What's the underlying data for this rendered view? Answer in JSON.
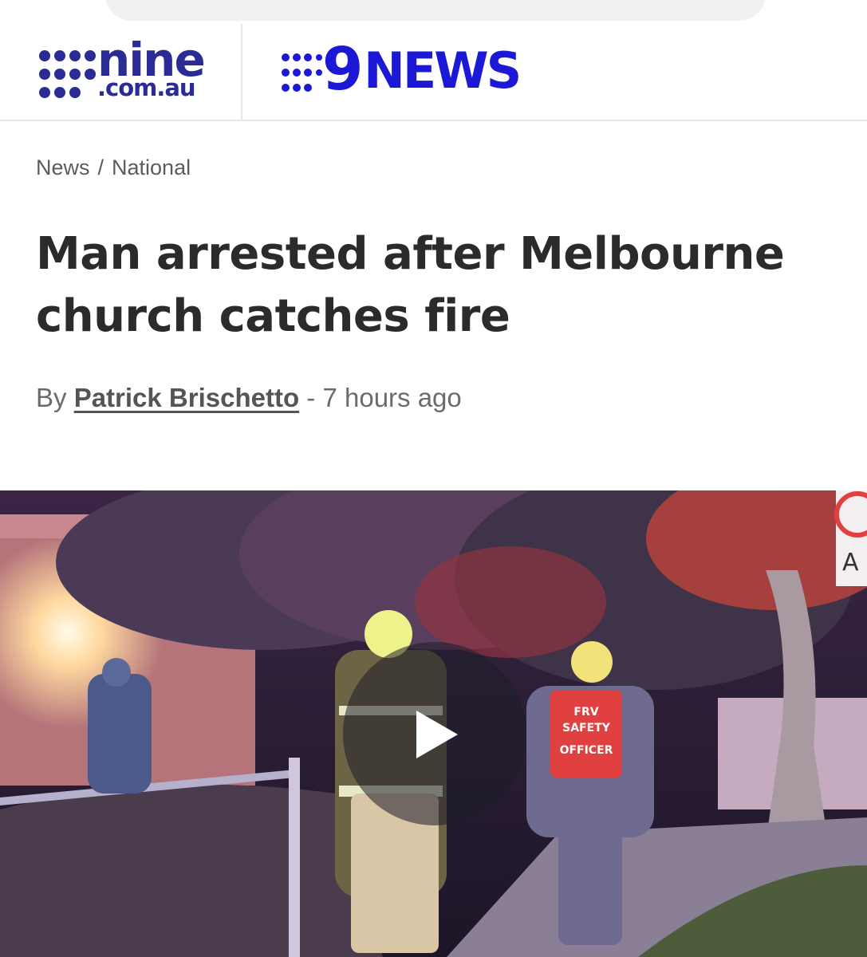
{
  "header": {
    "nine_logo": {
      "word": "nine",
      "domain": ".com.au",
      "color": "#2b2b96"
    },
    "news_logo": {
      "numeral": "9",
      "word": "NEWS",
      "color": "#1b18d6"
    }
  },
  "breadcrumb": {
    "items": [
      "News",
      "National"
    ],
    "separator": "/"
  },
  "article": {
    "headline": "Man arrested after Melbourne church catches fire",
    "byline_prefix": "By",
    "author": "Patrick Brischetto",
    "byline_sep": "-",
    "time": "7 hours ago"
  },
  "hero": {
    "vest_lines": [
      "FRV",
      "SAFETY",
      "OFFICER"
    ],
    "sign_letter": "A",
    "play_icon": "play-icon"
  }
}
